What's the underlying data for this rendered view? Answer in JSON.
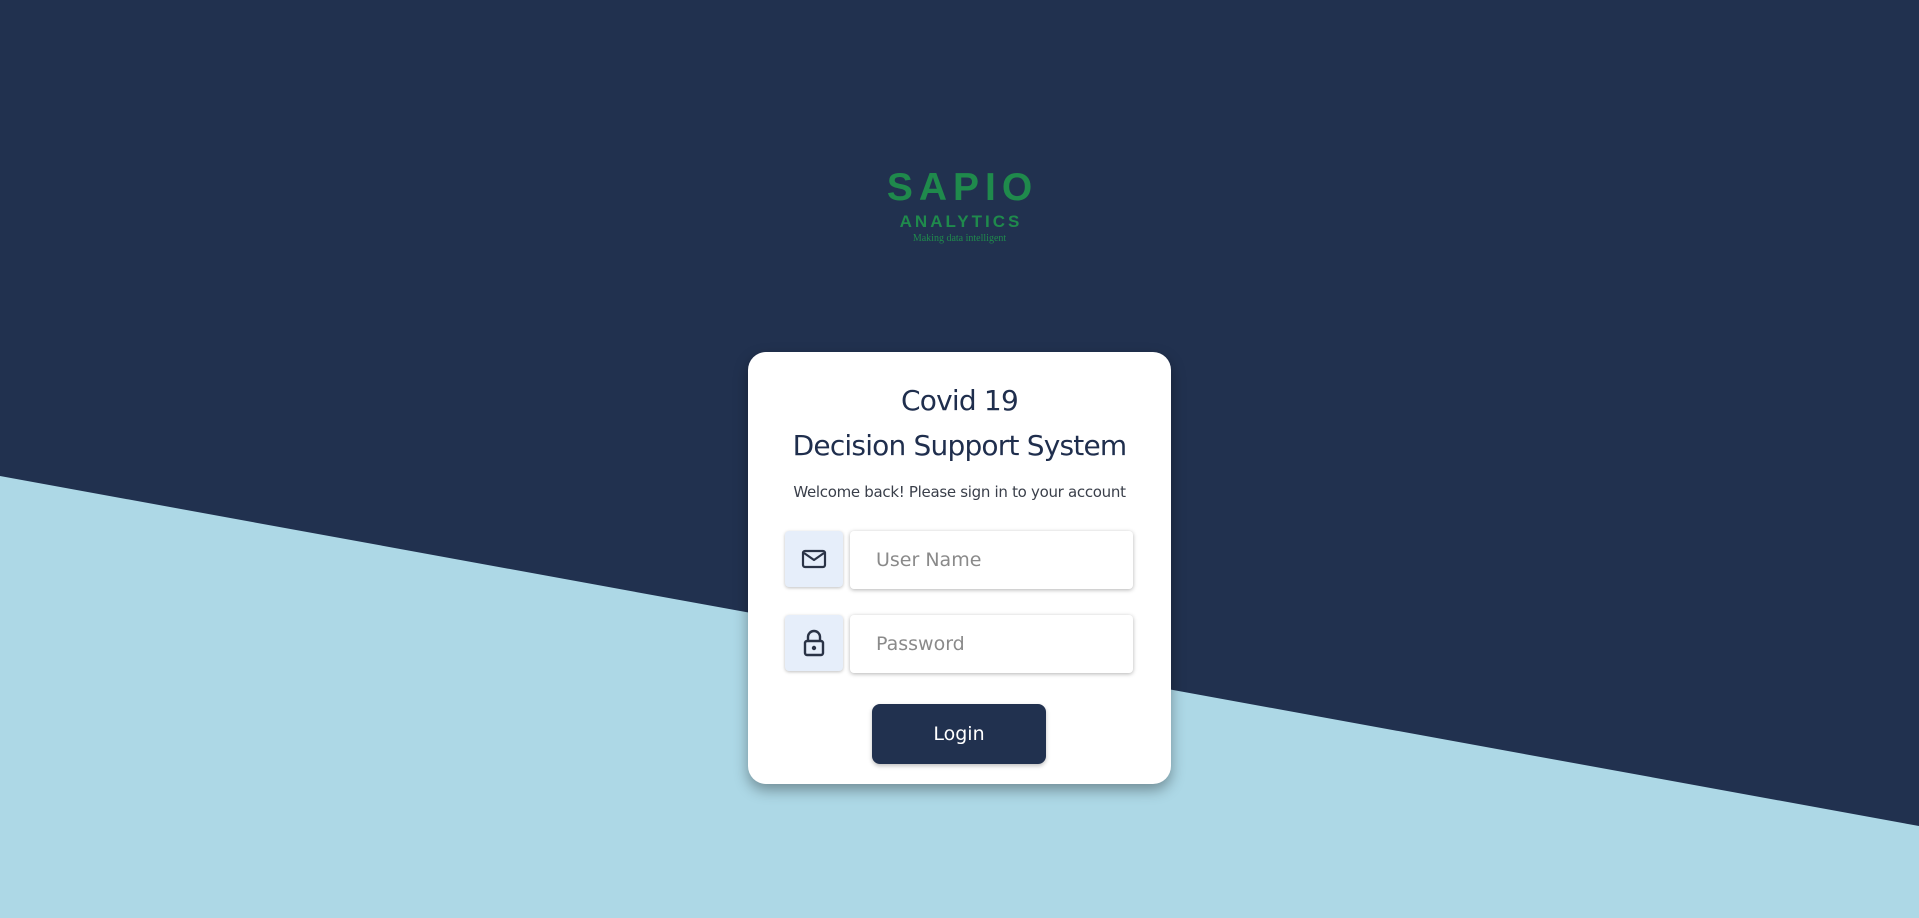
{
  "colors": {
    "background_dark": "#21314f",
    "background_light": "#add8e6",
    "brand_green": "#1f8a4c",
    "button": "#21314f"
  },
  "logo": {
    "main": "SAPIO",
    "sub": "ANALYTICS",
    "tagline": "Making data intelligent"
  },
  "login": {
    "title_line1": "Covid 19",
    "title_line2": "Decision Support System",
    "subtitle": "Welcome back! Please sign in to your account",
    "username": {
      "icon": "mail-icon",
      "placeholder": "User Name",
      "value": ""
    },
    "password": {
      "icon": "lock-icon",
      "placeholder": "Password",
      "value": ""
    },
    "button_label": "Login"
  }
}
